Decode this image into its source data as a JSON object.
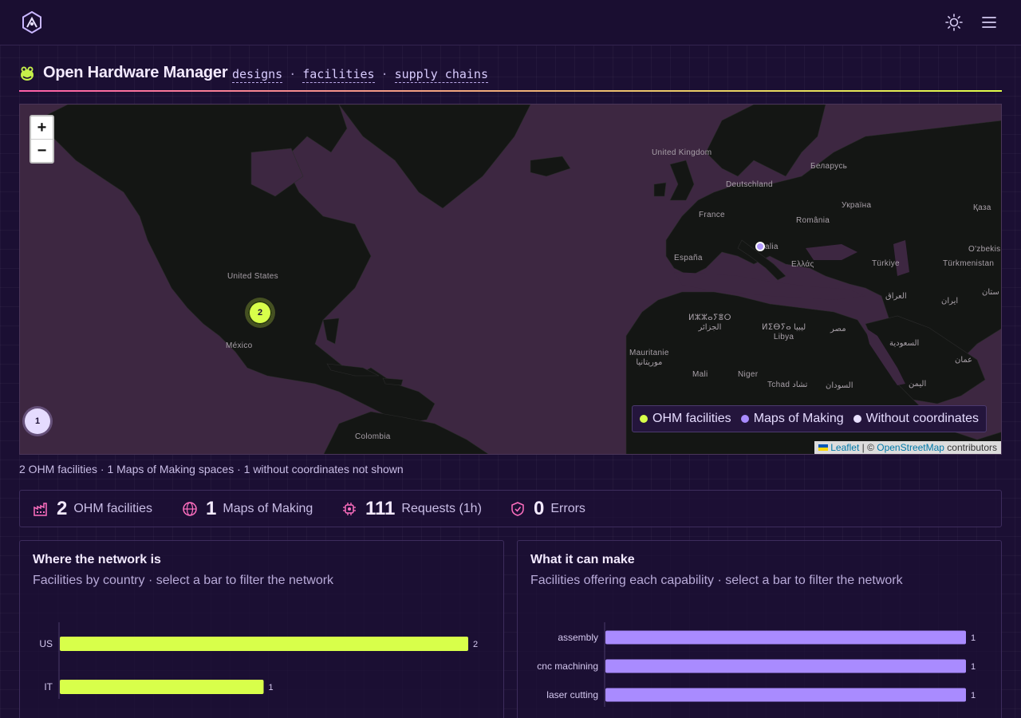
{
  "topbar": {
    "logo_icon": "ohm-logo-icon",
    "theme_icon": "sun-icon",
    "menu_icon": "hamburger-menu-icon"
  },
  "header": {
    "brand_icon": "frog-icon",
    "title": "Open Hardware Manager",
    "nav": [
      {
        "label": "designs"
      },
      {
        "label": "facilities"
      },
      {
        "label": "supply chains"
      }
    ],
    "separator": "·"
  },
  "map": {
    "zoom_in": "+",
    "zoom_out": "−",
    "labels": [
      {
        "text": "United Kingdom"
      },
      {
        "text": "Беларусь"
      },
      {
        "text": "Deutschland"
      },
      {
        "text": "Україна"
      },
      {
        "text": "Қаза"
      },
      {
        "text": "France"
      },
      {
        "text": "România"
      },
      {
        "text": "alia"
      },
      {
        "text": "O'zbekis"
      },
      {
        "text": "España"
      },
      {
        "text": "Ελλάς"
      },
      {
        "text": "Türkiye"
      },
      {
        "text": "Türkmenistan"
      },
      {
        "text": "United States"
      },
      {
        "text": "العراق"
      },
      {
        "text": "ایران"
      },
      {
        "text": "ستان"
      },
      {
        "text": "ⵍⵣⵣⴰⵢⴻⵔ\nالجزائر"
      },
      {
        "text": "ⵍⵉⴱⵢⴰ ليبيا\nLibya"
      },
      {
        "text": "مصر"
      },
      {
        "text": "México"
      },
      {
        "text": "السعودية"
      },
      {
        "text": "Mauritanie\nموريتانيا"
      },
      {
        "text": "عمان"
      },
      {
        "text": "Mali"
      },
      {
        "text": "Niger"
      },
      {
        "text": "Tchad تشاد"
      },
      {
        "text": "السودان"
      },
      {
        "text": "اليمن"
      },
      {
        "text": "Colombia"
      }
    ],
    "clusters": {
      "ohm": "2",
      "no_coordinates": "1"
    },
    "legend": [
      {
        "label": "OHM facilities",
        "color": "#d8ff4a"
      },
      {
        "label": "Maps of Making",
        "color": "#a98bff"
      },
      {
        "label": "Without coordinates",
        "color": "#e8e0ff"
      }
    ],
    "attribution": {
      "leaflet": "Leaflet",
      "sep": " | © ",
      "osm": "OpenStreetMap",
      "contributors": " contributors"
    }
  },
  "map_caption": "2 OHM facilities · 1 Maps of Making spaces · 1 without coordinates not shown",
  "stats": [
    {
      "icon": "factory-icon",
      "value": "2",
      "label": "OHM facilities"
    },
    {
      "icon": "globe-icon",
      "value": "1",
      "label": "Maps of Making"
    },
    {
      "icon": "cpu-chip-icon",
      "value": "111",
      "label": "Requests (1h)"
    },
    {
      "icon": "shield-icon",
      "value": "0",
      "label": "Errors"
    }
  ],
  "panels": {
    "country": {
      "title": "Where the network is",
      "subtitle": "Facilities by country · select a bar to filter the network"
    },
    "capability": {
      "title": "What it can make",
      "subtitle": "Facilities offering each capability · select a bar to filter the network"
    }
  },
  "chart_data": [
    {
      "type": "bar",
      "orientation": "horizontal",
      "title": "Where the network is",
      "categories": [
        "US",
        "IT"
      ],
      "values": [
        2,
        1
      ],
      "xlim": [
        0,
        2
      ],
      "x_ticks": [
        "0",
        "0.5",
        "1",
        "1.5",
        "2"
      ],
      "color": "#d8ff4a"
    },
    {
      "type": "bar",
      "orientation": "horizontal",
      "title": "What it can make",
      "categories": [
        "assembly",
        "cnc machining",
        "laser cutting"
      ],
      "values": [
        1,
        1,
        1
      ],
      "xlim": [
        0,
        1
      ],
      "x_ticks": [
        "0",
        "0.2",
        "0.4",
        "0.6",
        "0.8",
        "1"
      ],
      "color": "#a98bff"
    }
  ]
}
